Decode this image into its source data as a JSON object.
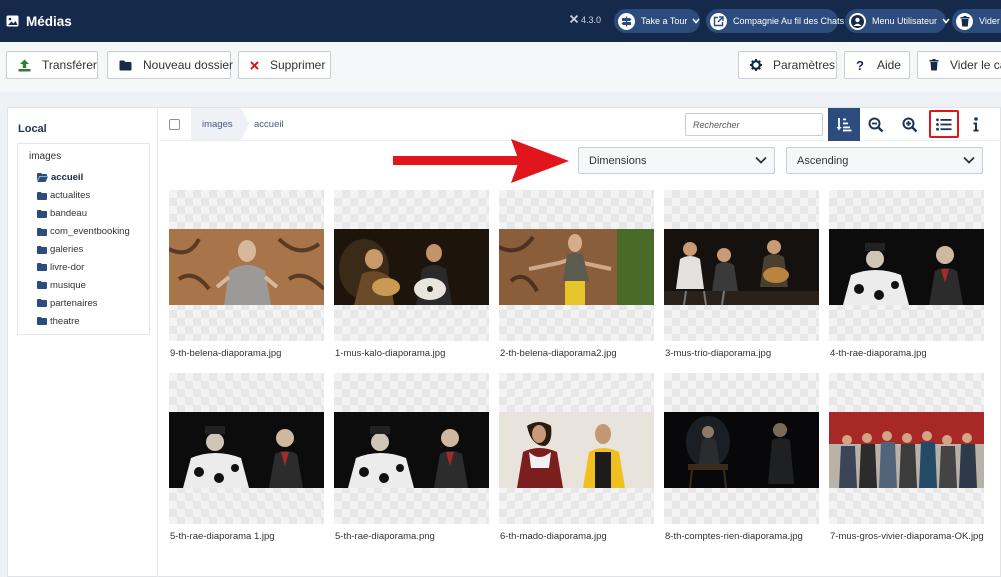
{
  "header": {
    "title": "Médias",
    "version": "4.3.0",
    "buttons": [
      {
        "label": "Take a Tour",
        "icon": "signpost-icon"
      },
      {
        "label": "Compagnie Au fil des Chats",
        "icon": "external-link-icon"
      },
      {
        "label": "Menu Utilisateur",
        "icon": "user-circle-icon"
      },
      {
        "label": "Vider l",
        "icon": "trash-icon"
      }
    ]
  },
  "toolbar": {
    "upload_label": "Transférer",
    "new_folder_label": "Nouveau dossier",
    "delete_label": "Supprimer",
    "options_label": "Paramètres",
    "help_label": "Aide",
    "empty_cache_label": "Vider le ca"
  },
  "sidebar": {
    "title": "Local",
    "root": "images",
    "items": [
      "accueil",
      "actualites",
      "bandeau",
      "com_eventbooking",
      "galeries",
      "livre-dor",
      "musique",
      "partenaires",
      "theatre"
    ],
    "active": "accueil"
  },
  "breadcrumb": [
    "images",
    "accueil"
  ],
  "search": {
    "placeholder": "Rechercher"
  },
  "sort": {
    "field": "Dimensions",
    "order": "Ascending"
  },
  "files": [
    "9-th-belena-diaporama.jpg",
    "1-mus-kalo-diaporama.jpg",
    "2-th-belena-diaporama2.jpg",
    "3-mus-trio-diaporama.jpg",
    "4-th-rae-diaporama.jpg",
    "5-th-rae-diaporama 1.jpg",
    "5-th-rae-diaporama.png",
    "6-th-mado-diaporama.jpg",
    "8-th-comptes-rien-diaporama.jpg",
    "7-mus-gros-vivier-diaporama-OK.jpg"
  ],
  "colors": {
    "header_bg": "#152a4a",
    "accent": "#2c4c7d",
    "highlight": "#e1151b"
  }
}
